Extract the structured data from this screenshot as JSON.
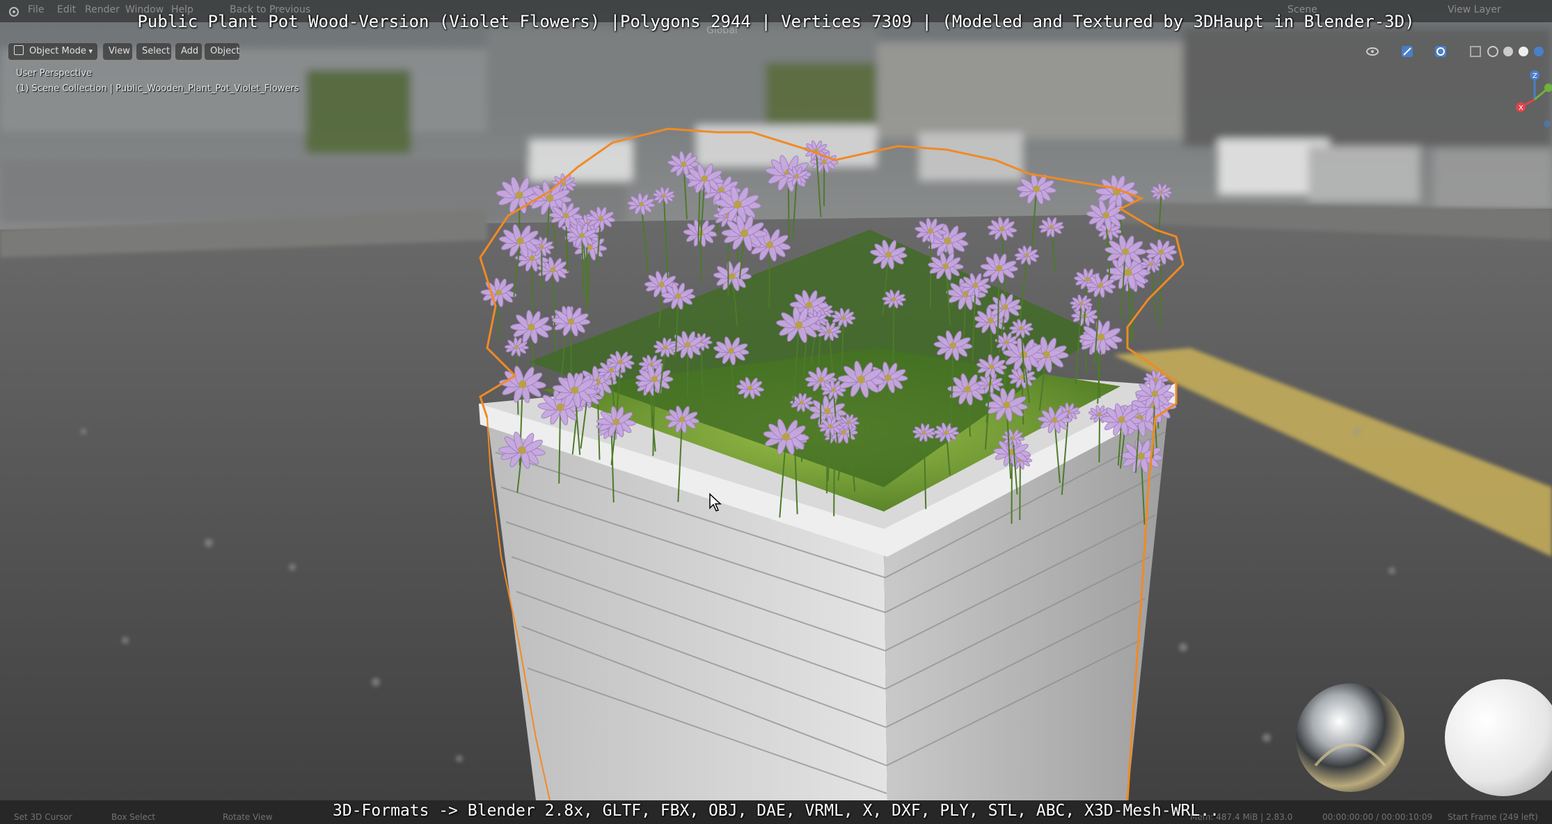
{
  "overlay": {
    "title": "Public Plant Pot Wood-Version (Violet Flowers) |Polygons 2944 | Vertices 7309 | (Modeled and Textured by 3DHaupt in Blender-3D)",
    "formats": "3D-Formats -> Blender 2.8x, GLTF, FBX, OBJ, DAE, VRML, X, DXF, PLY, STL, ABC, X3D-Mesh-WRL.."
  },
  "topbar": {
    "menu": [
      "File",
      "Edit",
      "Render",
      "Window",
      "Help"
    ],
    "back_to_previous": "Back to Previous",
    "scene_label": "Scene",
    "view_layer_label": "View Layer"
  },
  "header": {
    "mode": "Object Mode",
    "view": "View",
    "select": "Select",
    "add": "Add",
    "object": "Object",
    "orientation": "Global"
  },
  "viewport": {
    "view_name": "User Perspective",
    "collection_info": "(1) Scene Collection | Public_Wooden_Plant_Pot_Violet_Flowers"
  },
  "statusbar": {
    "left_action": "Set 3D Cursor",
    "middle_action": "Box Select",
    "right_action": "Rotate View",
    "stats": "Mem: 487.4 MiB | 2.83.0",
    "time": "00:00:00:00 / 00:00:10:09",
    "frame": "Start Frame (249 left)"
  },
  "colors": {
    "selection_outline": "#f08a24",
    "flower_petal": "#c7a8e0",
    "planter_wood": "#d6d6d6",
    "road_line": "#c9b15a"
  },
  "icons": [
    "blender-logo-icon",
    "object-mode-icon",
    "chevron-down-icon",
    "axes-gizmo-icon",
    "mouse-cursor-icon"
  ]
}
